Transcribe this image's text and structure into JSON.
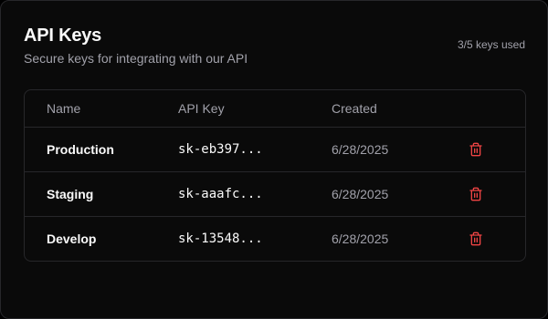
{
  "header": {
    "title": "API Keys",
    "subtitle": "Secure keys for integrating with our API",
    "usage": "3/5 keys used"
  },
  "table": {
    "columns": [
      "Name",
      "API Key",
      "Created"
    ],
    "rows": [
      {
        "name": "Production",
        "key": "sk-eb397...",
        "created": "6/28/2025",
        "action_icon": "trash-icon"
      },
      {
        "name": "Staging",
        "key": "sk-aaafc...",
        "created": "6/28/2025",
        "action_icon": "trash-icon"
      },
      {
        "name": "Develop",
        "key": "sk-13548...",
        "created": "6/28/2025",
        "action_icon": "trash-icon"
      }
    ]
  },
  "colors": {
    "background": "#0a0a0a",
    "border": "#27272a",
    "muted_text": "#a1a1aa",
    "danger": "#ef4444"
  }
}
